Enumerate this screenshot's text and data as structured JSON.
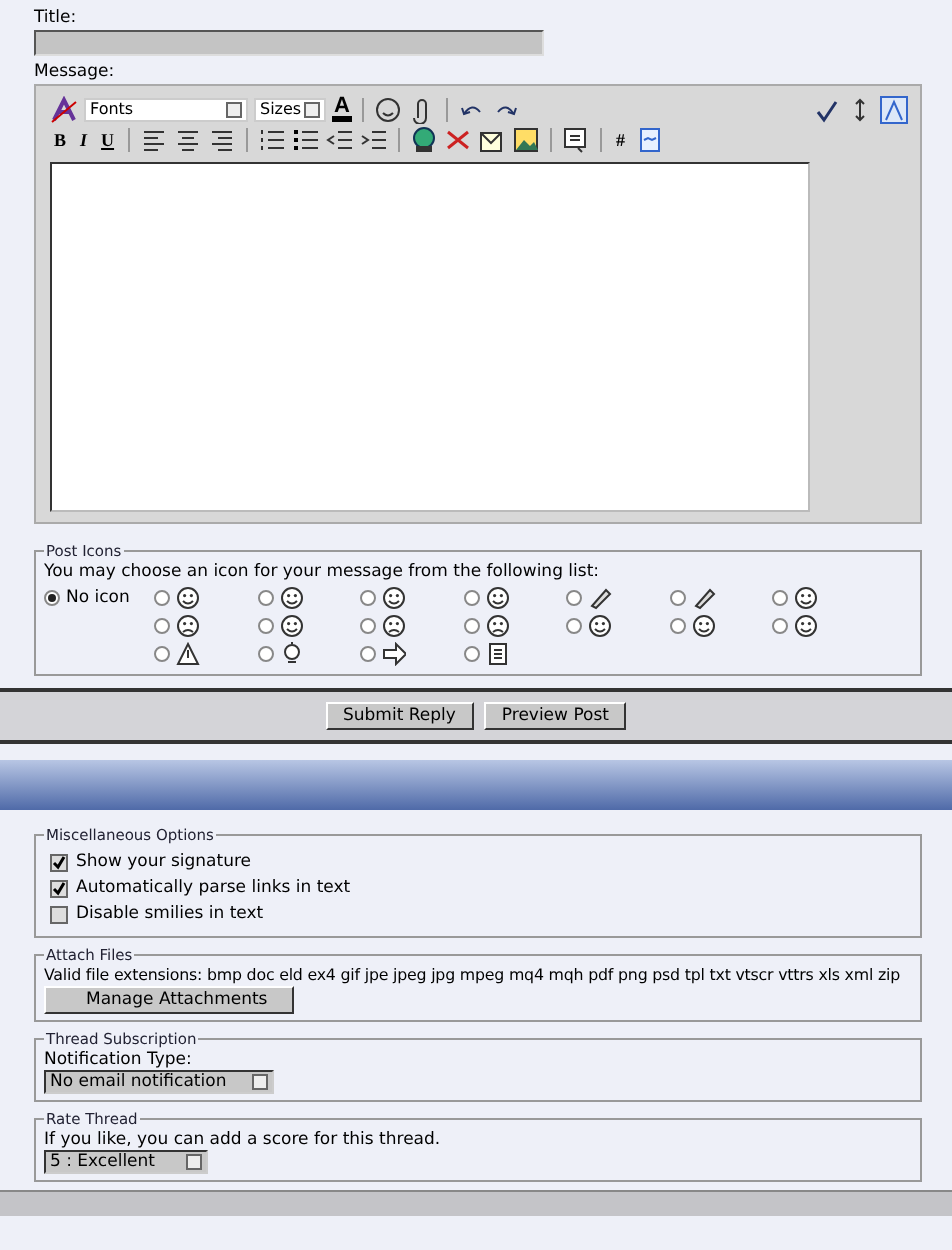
{
  "title_field": {
    "label": "Title:"
  },
  "message": {
    "label": "Message:",
    "font_select": "Fonts",
    "size_select": "Sizes",
    "color_letter": "A",
    "format_buttons": [
      "B",
      "I",
      "U"
    ],
    "hash_button": "#"
  },
  "post_icons": {
    "legend": "Post Icons",
    "intro": "You may choose an icon for your message from the following list:",
    "items": [
      {
        "label": "No icon",
        "selected": true
      },
      {
        "selected": false
      },
      {
        "selected": false
      },
      {
        "selected": false
      },
      {
        "selected": false
      },
      {
        "selected": false
      },
      {
        "selected": false
      },
      {
        "selected": false
      },
      {
        "selected": false
      },
      {
        "selected": false
      },
      {
        "selected": false
      },
      {
        "selected": false
      },
      {
        "selected": false
      },
      {
        "selected": false
      },
      {
        "selected": false
      },
      {
        "selected": false
      },
      {
        "selected": false
      },
      {
        "selected": false
      },
      {
        "selected": false
      }
    ]
  },
  "actions": [
    "Submit Reply",
    "Preview Post"
  ],
  "misc": {
    "legend": "Miscellaneous Options",
    "options": [
      {
        "label": "Show your signature",
        "checked": true
      },
      {
        "label": "Automatically parse links in text",
        "checked": true
      },
      {
        "label": "Disable smilies in text",
        "checked": false
      }
    ]
  },
  "attach": {
    "legend": "Attach Files",
    "text": "Valid file extensions: bmp doc eld ex4 gif jpe jpeg jpg mpeg mq4 mqh pdf png psd tpl txt vtscr vttrs xls xml zip",
    "button": "Manage Attachments"
  },
  "subscription": {
    "legend": "Thread Subscription",
    "label": "Notification Type:",
    "value": "No email notification"
  },
  "rating": {
    "legend": "Rate Thread",
    "text": "If you like, you can add a score for this thread.",
    "value": "5 : Excellent"
  }
}
